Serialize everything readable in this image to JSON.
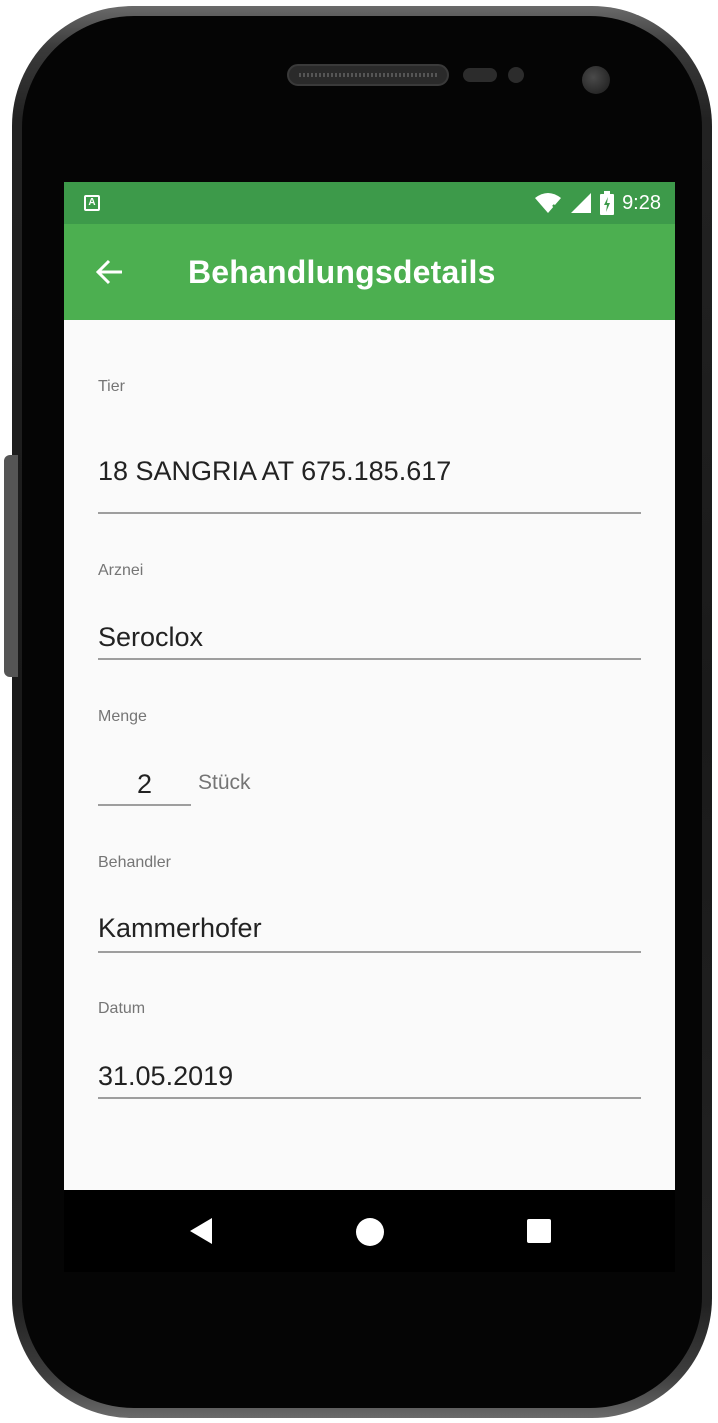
{
  "status_bar": {
    "time": "9:28",
    "notification_icon": "a-square-icon",
    "icons": [
      "wifi-off-icon",
      "signal-icon",
      "battery-charging-icon"
    ]
  },
  "app_bar": {
    "title": "Behandlungsdetails",
    "back_icon": "arrow-left-icon",
    "color": "#4caf50",
    "status_color": "#3d9a4a"
  },
  "form": {
    "tier": {
      "label": "Tier",
      "value": "18  SANGRIA  AT 675.185.617"
    },
    "arznei": {
      "label": "Arznei",
      "value": "Seroclox"
    },
    "menge": {
      "label": "Menge",
      "value": "2",
      "unit": "Stück"
    },
    "behandler": {
      "label": "Behandler",
      "value": "Kammerhofer"
    },
    "datum": {
      "label": "Datum",
      "value": "31.05.2019"
    }
  },
  "nav_bar": {
    "icons": [
      "back-triangle-icon",
      "home-circle-icon",
      "recents-square-icon"
    ]
  }
}
